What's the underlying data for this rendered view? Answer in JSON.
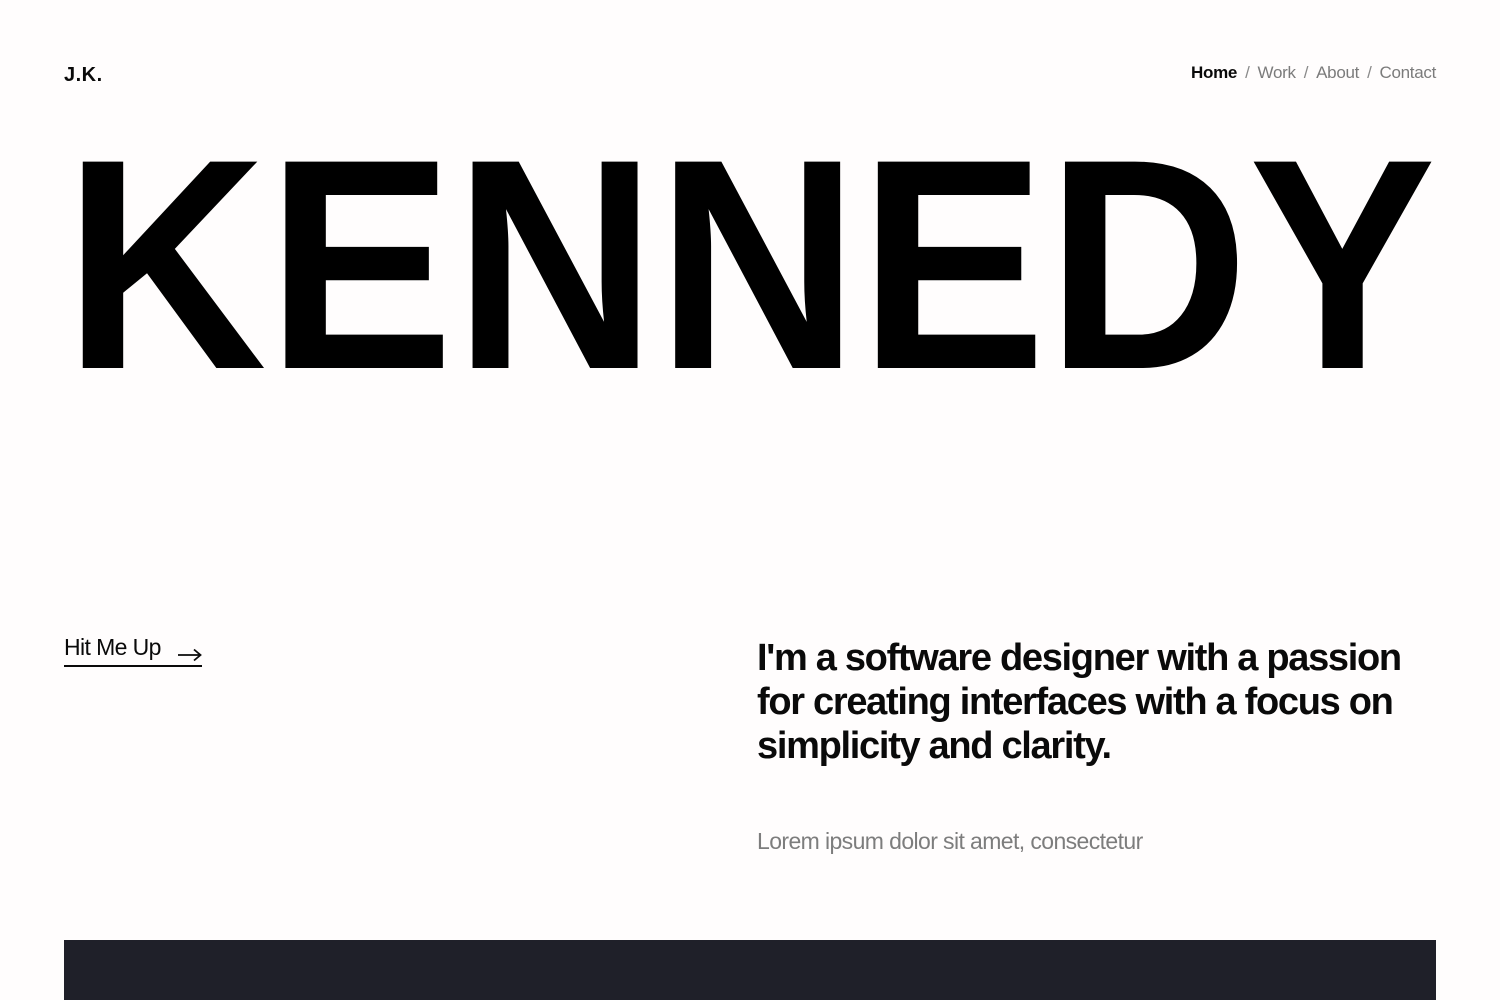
{
  "header": {
    "logo": "J.K.",
    "nav": [
      {
        "label": "Home",
        "active": true
      },
      {
        "label": "Work",
        "active": false
      },
      {
        "label": "About",
        "active": false
      },
      {
        "label": "Contact",
        "active": false
      }
    ],
    "separator": "/"
  },
  "hero": {
    "title": "KENNEDY"
  },
  "cta": {
    "label": "Hit Me Up",
    "icon": "arrow-right-icon"
  },
  "intro": {
    "tagline": "I'm a software designer with a passion for creating interfaces with a focus on simplicity and clarity.",
    "subtext": "Lorem ipsum dolor sit amet, consectetur"
  },
  "colors": {
    "background": "#fffdfd",
    "text": "#0a0a0a",
    "muted": "#7d7d7d",
    "dark_band": "#1f2029"
  }
}
